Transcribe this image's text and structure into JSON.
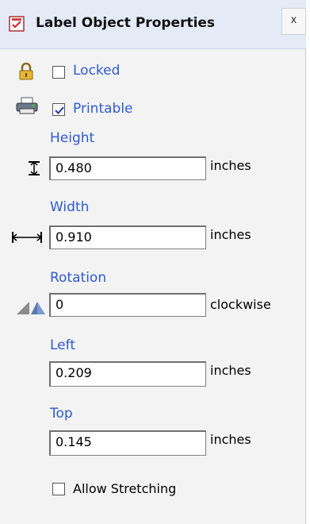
{
  "panel": {
    "title": "Label Object Properties",
    "close_label": "x"
  },
  "locked": {
    "label": "Locked",
    "checked": false
  },
  "printable": {
    "label": "Printable",
    "checked": true
  },
  "height": {
    "label": "Height",
    "value": "0.480",
    "unit": "inches"
  },
  "width": {
    "label": "Width",
    "value": "0.910",
    "unit": "inches"
  },
  "rotation": {
    "label": "Rotation",
    "value": "0",
    "unit": "clockwise"
  },
  "left": {
    "label": "Left",
    "value": "0.209",
    "unit": "inches"
  },
  "top": {
    "label": "Top",
    "value": "0.145",
    "unit": "inches"
  },
  "allow_stretching": {
    "label": "Allow Stretching",
    "checked": false
  },
  "colors": {
    "label_blue": "#2d5bd3",
    "titlebar": "#e4ebf6",
    "panel_bg": "#f3f3f3"
  }
}
